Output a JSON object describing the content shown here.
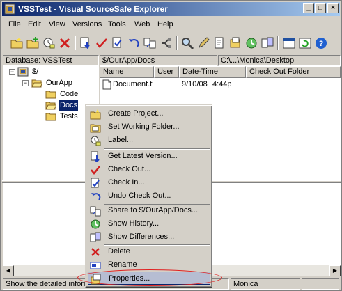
{
  "window": {
    "title": "VSSTest - Visual SourceSafe Explorer"
  },
  "menubar": {
    "items": [
      "File",
      "Edit",
      "View",
      "Versions",
      "Tools",
      "Web",
      "Help"
    ]
  },
  "panes": {
    "database_label": "Database: VSSTest",
    "current_project": "$/OurApp/Docs",
    "working_folder": "C:\\...\\Monica\\Desktop"
  },
  "tree": {
    "root": "$/",
    "project": "OurApp",
    "children": [
      "Code",
      "Docs",
      "Tests"
    ],
    "selected": "Docs"
  },
  "file_list": {
    "columns": [
      "Name",
      "User",
      "Date-Time",
      "Check Out Folder"
    ],
    "rows": [
      {
        "name": "Document.tx",
        "user": "",
        "date": "9/10/08",
        "time": "4:44p"
      }
    ]
  },
  "context_menu": {
    "items": [
      {
        "label": "Create Project...",
        "icon": "new-project-icon"
      },
      {
        "label": "Set Working Folder...",
        "icon": "working-folder-icon"
      },
      {
        "label": "Label...",
        "icon": "label-icon"
      },
      {
        "sep": true
      },
      {
        "label": "Get Latest Version...",
        "icon": "get-latest-icon"
      },
      {
        "label": "Check Out...",
        "icon": "checkmark-icon"
      },
      {
        "label": "Check In...",
        "icon": "check-in-icon"
      },
      {
        "label": "Undo Check Out...",
        "icon": "undo-icon"
      },
      {
        "sep": true
      },
      {
        "label": "Share to $/OurApp/Docs...",
        "icon": "share-icon"
      },
      {
        "label": "Show History...",
        "icon": "history-icon"
      },
      {
        "label": "Show Differences...",
        "icon": "differences-icon"
      },
      {
        "sep": true
      },
      {
        "label": "Delete",
        "icon": "delete-icon"
      },
      {
        "label": "Rename",
        "icon": "rename-icon"
      },
      {
        "label": "Properties...",
        "icon": "properties-icon",
        "highlighted": true
      }
    ]
  },
  "status": {
    "hint": "Show the detailed information",
    "user": "Monica"
  },
  "colors": {
    "title_start": "#0a246a",
    "title_end": "#a6caf0",
    "highlight": "#0a246a",
    "annotation": "#e02020"
  }
}
